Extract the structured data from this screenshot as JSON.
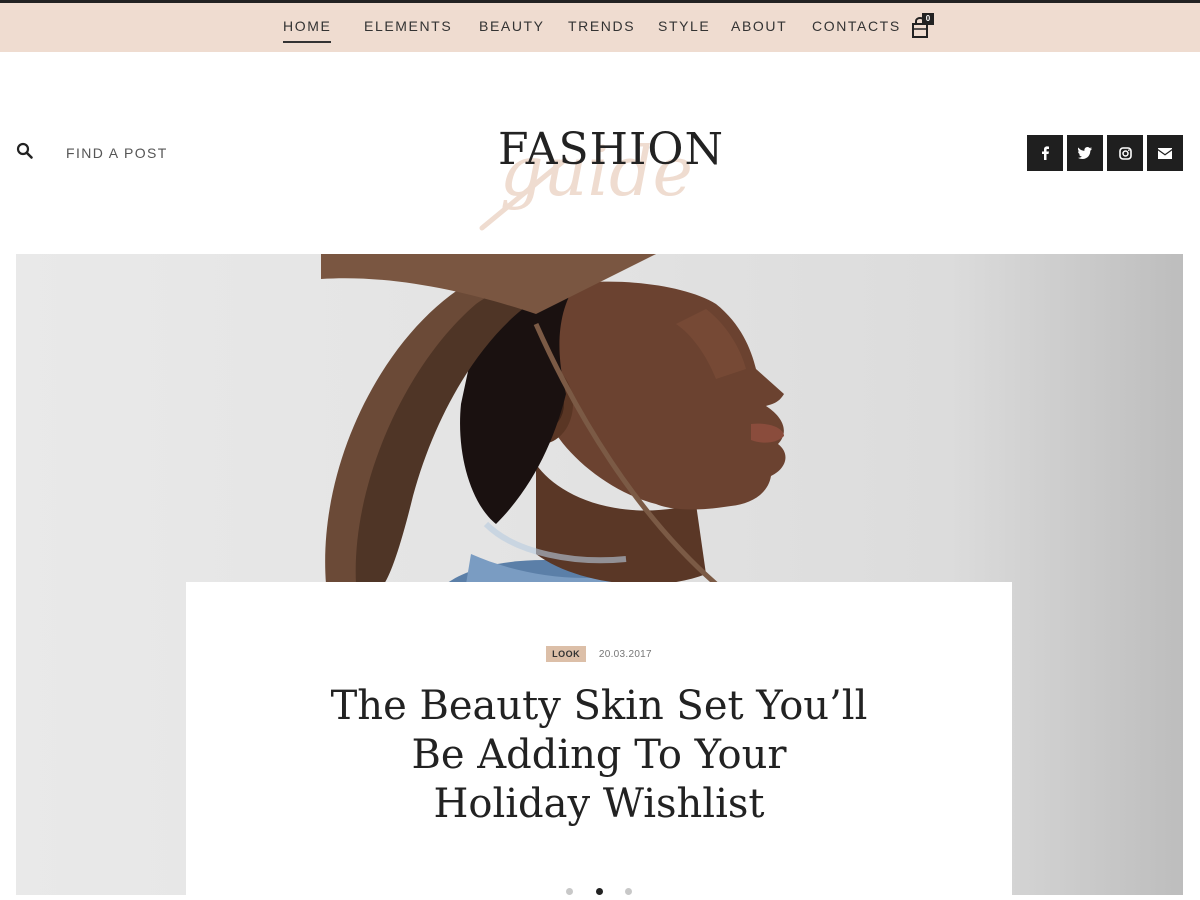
{
  "nav": {
    "items": [
      {
        "label": "HOME",
        "active": true
      },
      {
        "label": "ELEMENTS",
        "active": false
      },
      {
        "label": "BEAUTY",
        "active": false
      },
      {
        "label": "TRENDS",
        "active": false
      },
      {
        "label": "STYLE",
        "active": false
      },
      {
        "label": "ABOUT",
        "active": false
      },
      {
        "label": "CONTACTS",
        "active": false
      }
    ],
    "cart_count": "0"
  },
  "header": {
    "search_label": "FIND A POST",
    "logo_text": "FASHION",
    "logo_script": "guide",
    "social": [
      "facebook-icon",
      "twitter-icon",
      "instagram-icon",
      "envelope-icon"
    ]
  },
  "hero": {
    "tag": "LOOK",
    "date": "20.03.2017",
    "headline_lines": [
      "The Beauty Skin Set You’ll",
      "Be Adding To Your",
      "Holiday Wishlist"
    ],
    "slide_count": 3,
    "active_slide": 2
  },
  "colors": {
    "nav_background": "#efdcd0",
    "tag_background": "#dcbfa8",
    "social_background": "#1f1f1f"
  }
}
